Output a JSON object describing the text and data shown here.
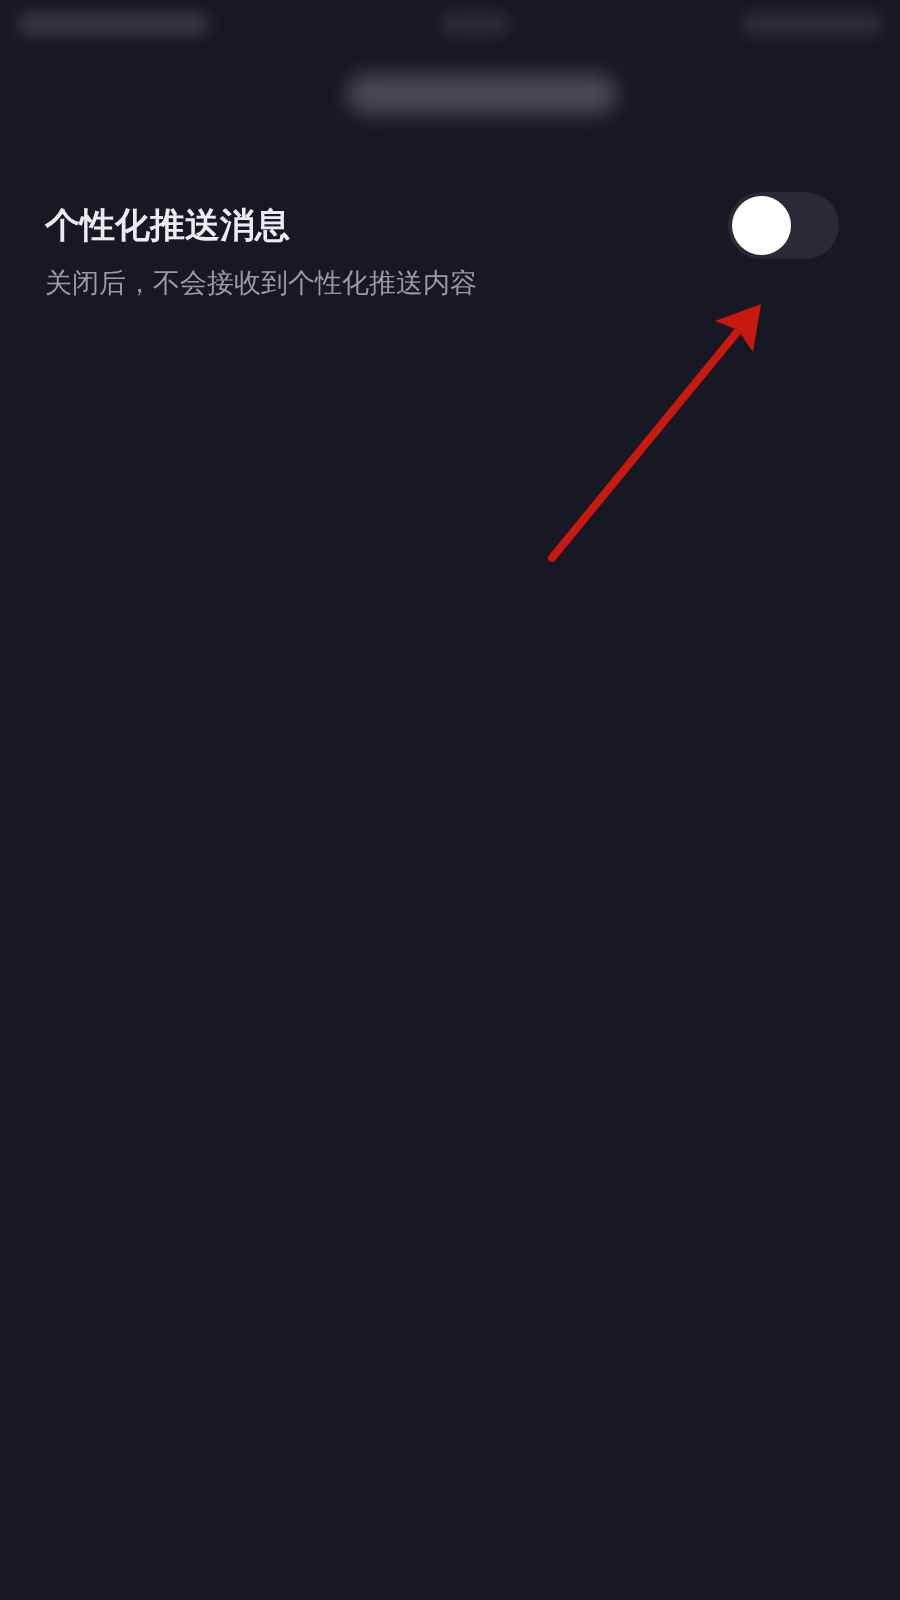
{
  "setting": {
    "title": "个性化推送消息",
    "description": "关闭后，不会接收到个性化推送内容",
    "on": false
  }
}
